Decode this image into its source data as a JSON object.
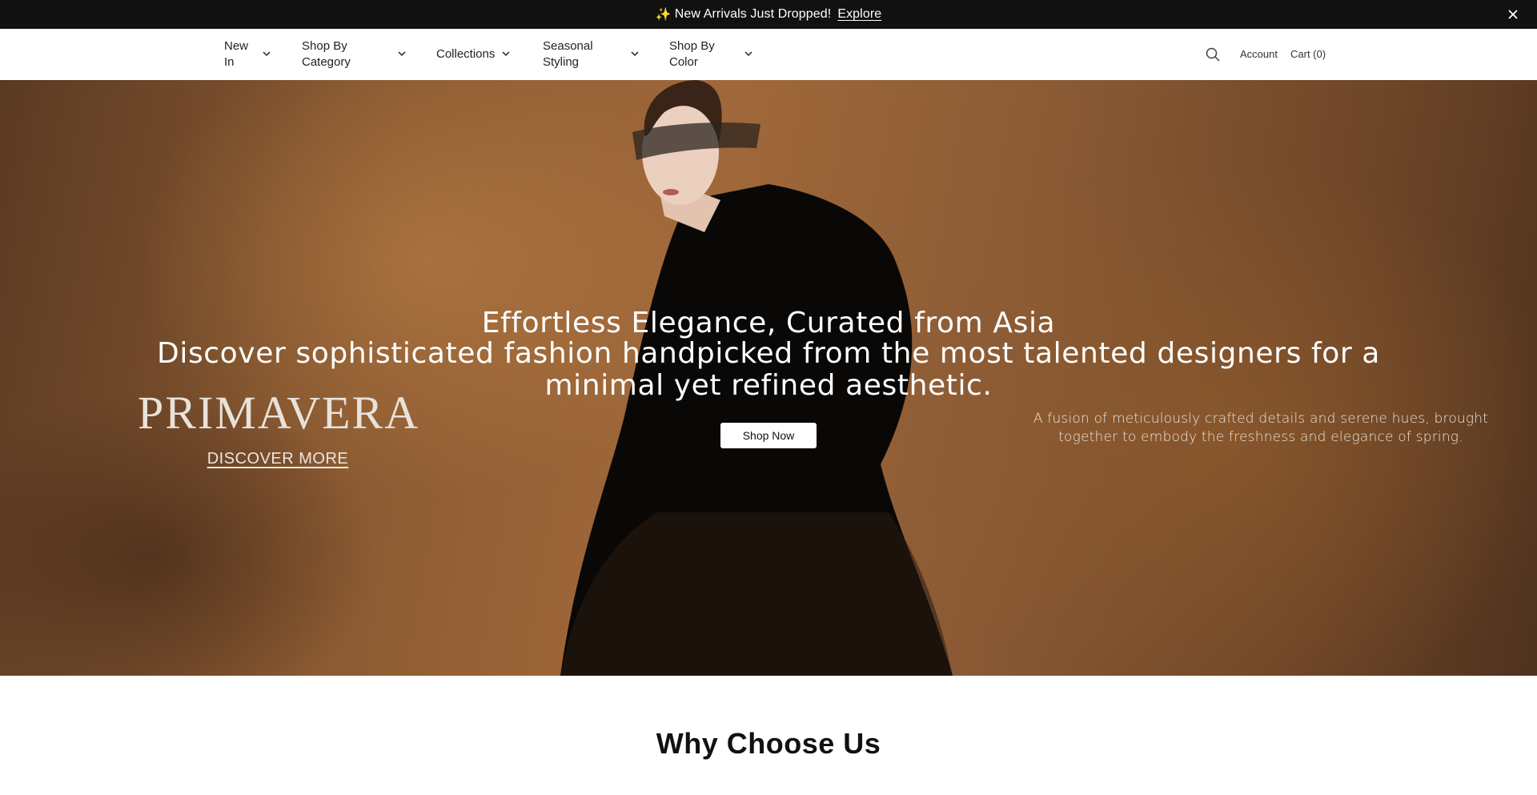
{
  "announcement": {
    "icon": "sparkles-icon",
    "message": "New Arrivals Just Dropped!",
    "link_label": "Explore"
  },
  "nav": {
    "items": [
      {
        "label": "New In"
      },
      {
        "label": "Shop By Category"
      },
      {
        "label": "Collections"
      },
      {
        "label": "Seasonal Styling"
      },
      {
        "label": "Shop By Color"
      }
    ],
    "account_label": "Account",
    "cart_label": "Cart (0)"
  },
  "hero": {
    "title": "Effortless Elegance, Curated from Asia",
    "subtitle": "Discover sophisticated fashion handpicked from the most talented designers for a minimal yet refined aesthetic.",
    "cta_label": "Shop Now",
    "brand_logo": "PRIMAVERA",
    "discover_label": "DISCOVER MORE",
    "description": "A fusion of meticulously crafted details and serene hues, brought together to embody the freshness and elegance of spring."
  },
  "section": {
    "heading": "Why Choose Us"
  },
  "colors": {
    "announce_bg": "#111111",
    "hero_tone": "#8b5a32",
    "button_bg": "#ffffff"
  }
}
